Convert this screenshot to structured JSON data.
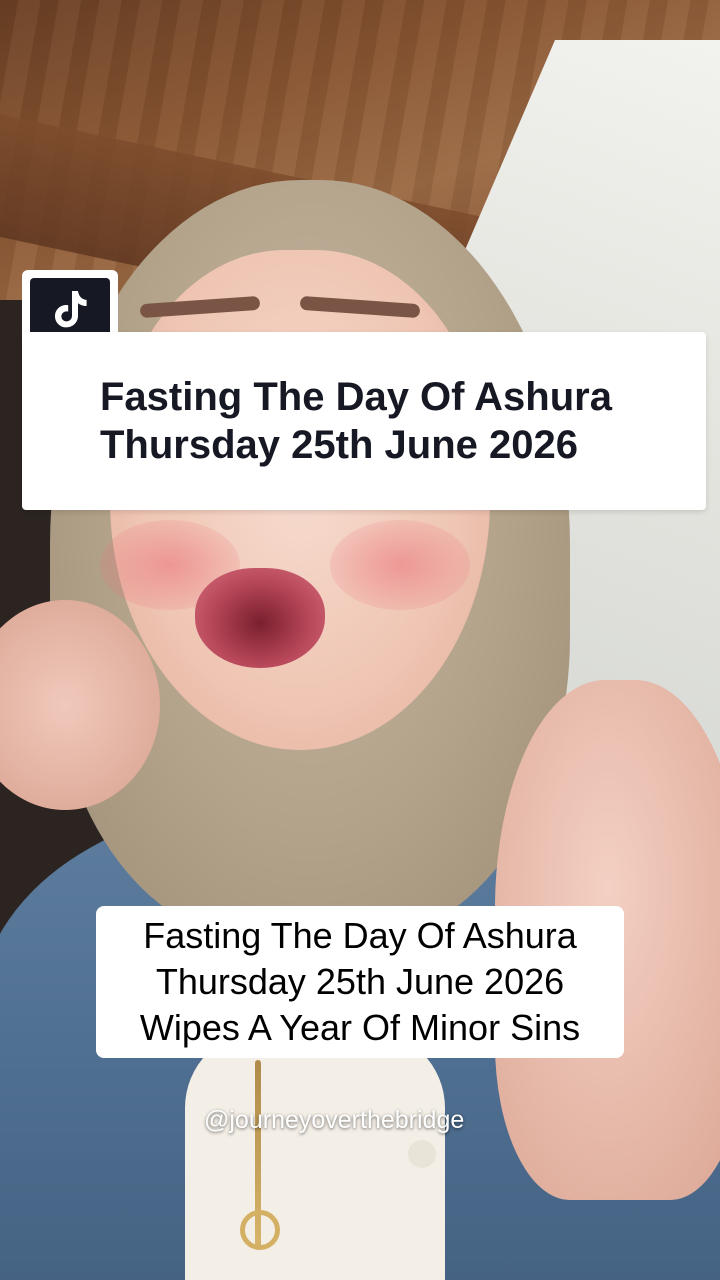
{
  "app": {
    "name": "TikTok",
    "logo_icon": "tiktok-logo-icon",
    "colors": {
      "badge_dark": "#161823",
      "card_bg": "#ffffff",
      "title_text": "#161823",
      "caption_text": "#000000",
      "username_text": "#ffffff"
    }
  },
  "title_card": {
    "line1": "Fasting The Day Of Ashura",
    "line2": "Thursday 25th June 2026"
  },
  "caption": {
    "line1": "Fasting The Day Of Ashura",
    "line2": "Thursday 25th June 2026",
    "line3": "Wipes A Year Of Minor Sins"
  },
  "watermark": {
    "username": "@journeyoverthebridge"
  }
}
